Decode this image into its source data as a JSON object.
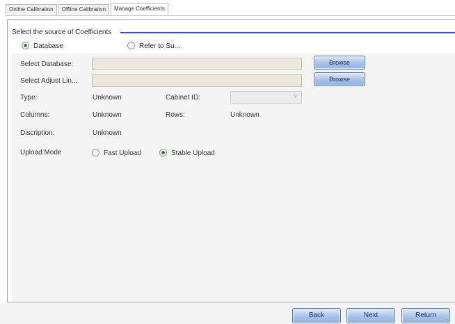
{
  "tabs": [
    {
      "label": "Online Calibration",
      "active": false
    },
    {
      "label": "Offline Calibration",
      "active": false
    },
    {
      "label": "Manage Coefficients",
      "active": true
    }
  ],
  "source": {
    "title": "Select the source of Coefficients",
    "options": [
      {
        "label": "Database",
        "selected": true
      },
      {
        "label": "Refer to Su...",
        "selected": false
      }
    ]
  },
  "form": {
    "select_database": {
      "label": "Select Database:",
      "value": "",
      "browse_label": "Browse"
    },
    "select_adjust": {
      "label": "Select Adjust Lin...",
      "value": "",
      "browse_label": "Browse"
    },
    "type": {
      "label": "Type:",
      "value": "Unknown"
    },
    "cabinet_id": {
      "label": "Cabinet ID:",
      "value": ""
    },
    "columns": {
      "label": "Columns:",
      "value": "Unknown"
    },
    "rows": {
      "label": "Rows:",
      "value": "Unknown"
    },
    "description": {
      "label": "Discription:",
      "value": "Unknown"
    },
    "upload_mode": {
      "label": "Upload Mode",
      "options": [
        {
          "label": "Fast Upload",
          "selected": false
        },
        {
          "label": "Stable Upload",
          "selected": true
        }
      ]
    }
  },
  "footer": {
    "back_label": "Back",
    "next_label": "Next",
    "return_label": "Return"
  },
  "colors": {
    "accent_line": "#3a4fb2",
    "button_blue": "#a8c3ea",
    "field_bg": "#ebe7dc",
    "radio_checked": "#3d7f3d"
  }
}
